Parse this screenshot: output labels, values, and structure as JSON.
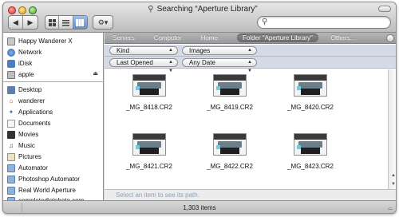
{
  "window": {
    "title": "Searching “Aperture Library”"
  },
  "toolbar": {
    "back_icon": "◀",
    "forward_icon": "▶",
    "action_icon": "⚙▾"
  },
  "sidebar": {
    "devices": [
      {
        "label": "Happy Wanderer X",
        "icon": "hard-drive-icon"
      },
      {
        "label": "Network",
        "icon": "globe-icon"
      },
      {
        "label": "iDisk",
        "icon": "idisk-icon"
      },
      {
        "label": "apple",
        "icon": "volume-icon"
      }
    ],
    "places": [
      {
        "label": "Desktop",
        "icon": "desktop-icon"
      },
      {
        "label": "wanderer",
        "icon": "home-icon"
      },
      {
        "label": "Applications",
        "icon": "applications-icon"
      },
      {
        "label": "Documents",
        "icon": "documents-icon"
      },
      {
        "label": "Movies",
        "icon": "movies-icon"
      },
      {
        "label": "Music",
        "icon": "music-icon"
      },
      {
        "label": "Pictures",
        "icon": "pictures-icon"
      },
      {
        "label": "Automator",
        "icon": "folder-icon"
      },
      {
        "label": "Photoshop Automator",
        "icon": "folder-icon"
      },
      {
        "label": "Real World Aperture",
        "icon": "folder-icon"
      },
      {
        "label": "completedigiphoto.com",
        "icon": "folder-icon"
      }
    ]
  },
  "scope": {
    "tabs": [
      "Servers",
      "Computer",
      "Home",
      "Folder “Aperture Library”",
      "Others..."
    ],
    "active_index": 3
  },
  "criteria": [
    {
      "attribute": "Kind",
      "value": "Images"
    },
    {
      "attribute": "Last Opened",
      "value": "Any Date"
    }
  ],
  "files": [
    "_MG_8418.CR2",
    "_MG_8419.CR2",
    "_MG_8420.CR2",
    "_MG_8421.CR2",
    "_MG_8422.CR2",
    "_MG_8423.CR2"
  ],
  "pathbar": {
    "hint": "Select an item to see its path."
  },
  "status": {
    "count": "1,303 items"
  }
}
